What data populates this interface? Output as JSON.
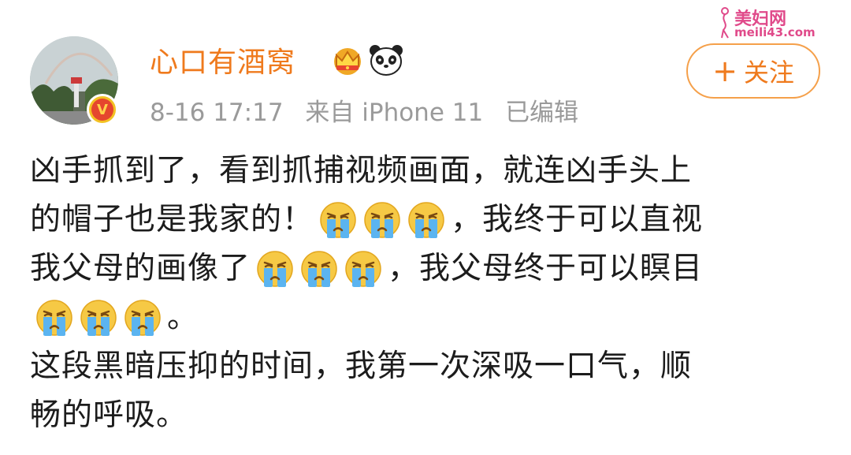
{
  "watermark": {
    "name": "美妇网",
    "url": "meili43.com"
  },
  "post": {
    "username": "心口有酒窝",
    "badges": [
      "crown-icon",
      "panda-icon"
    ],
    "verified": "V",
    "date": "8-16 17:17",
    "source": "来自 iPhone 11",
    "edited": "已编辑",
    "follow_plus": "+",
    "follow_label": "关注",
    "lines": [
      {
        "text": "凶手抓到了，看到抓捕视频画面，就连凶手头上"
      },
      {
        "pre": "的帽子也是我家的！",
        "emoji_count": 3,
        "post": "，我终于可以直视"
      },
      {
        "pre": "我父母的画像了",
        "emoji_count": 3,
        "post": "，我父母终于可以瞑目"
      },
      {
        "pre": "",
        "emoji_count": 3,
        "post": "。"
      },
      {
        "text": "这段黑暗压抑的时间，我第一次深吸一口气，顺"
      },
      {
        "text": "畅的呼吸。"
      }
    ],
    "emoji_name": "crying-face-icon"
  },
  "colors": {
    "accent": "#ef7a1d",
    "meta": "#9a9a9a",
    "text": "#1c1c1c",
    "watermark": "#e04a8a"
  }
}
